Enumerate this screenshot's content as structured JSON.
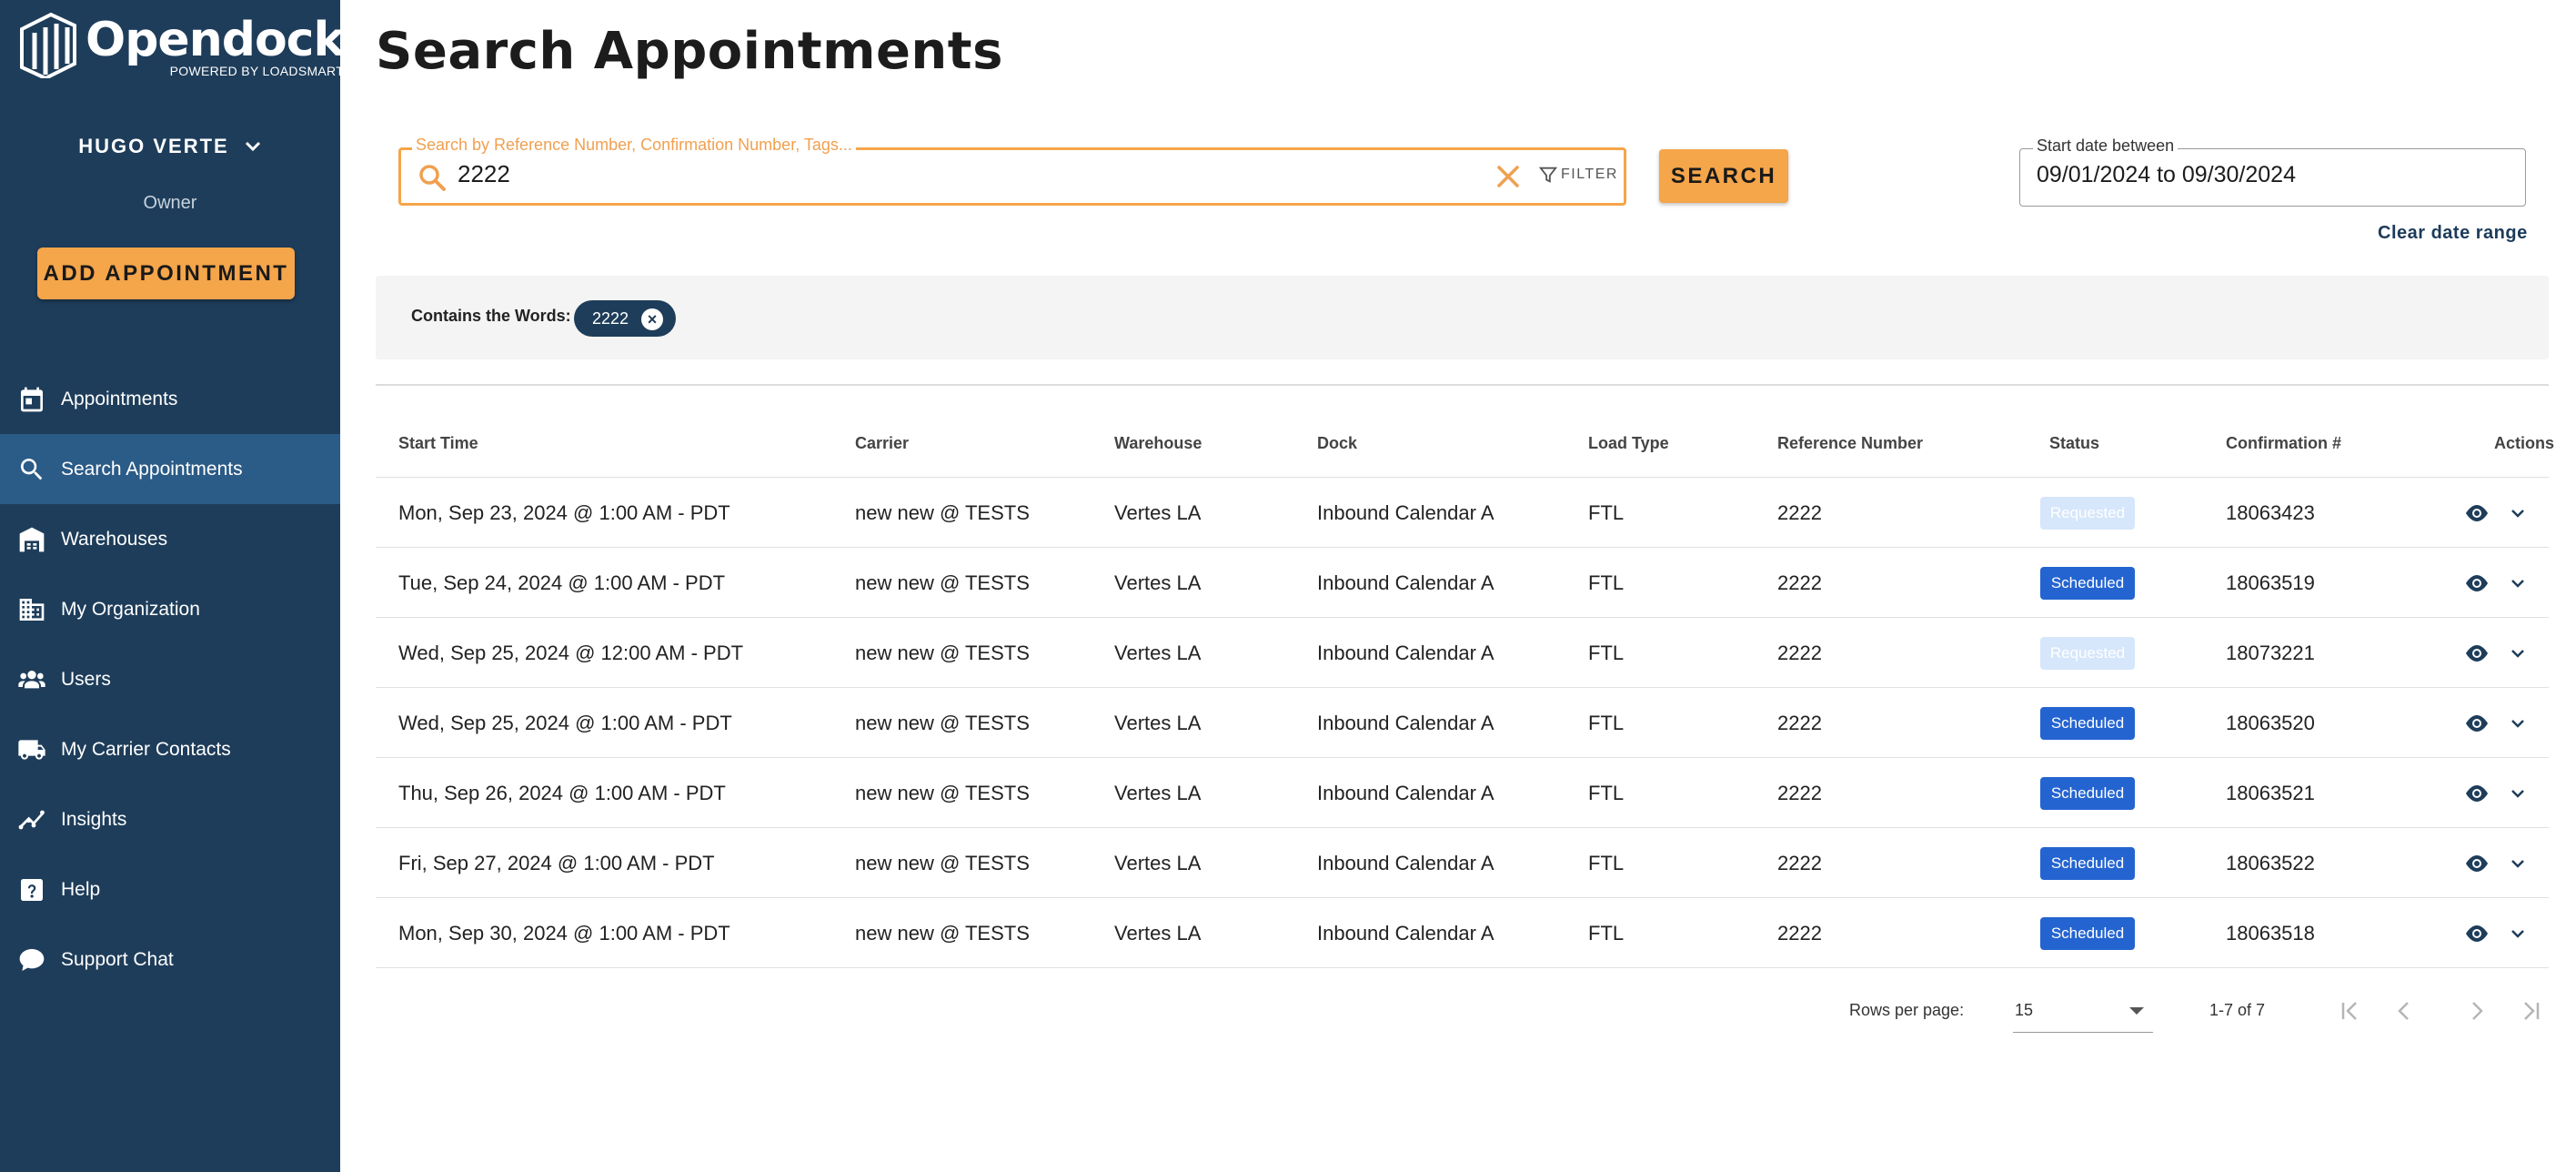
{
  "sidebar": {
    "brand": "Opendock",
    "brand_sub": "POWERED BY LOADSMART",
    "user_name": "HUGO VERTE",
    "user_role": "Owner",
    "add_button": "ADD APPOINTMENT",
    "items": [
      {
        "label": "Appointments",
        "icon": "calendar-icon"
      },
      {
        "label": "Search Appointments",
        "icon": "search-icon"
      },
      {
        "label": "Warehouses",
        "icon": "warehouse-icon"
      },
      {
        "label": "My Organization",
        "icon": "building-icon"
      },
      {
        "label": "Users",
        "icon": "users-icon"
      },
      {
        "label": "My Carrier Contacts",
        "icon": "truck-icon"
      },
      {
        "label": "Insights",
        "icon": "chart-line-icon"
      },
      {
        "label": "Help",
        "icon": "help-icon"
      },
      {
        "label": "Support Chat",
        "icon": "chat-icon"
      }
    ],
    "active_item": "Search Appointments"
  },
  "page": {
    "title": "Search Appointments"
  },
  "search": {
    "label": "Search by Reference Number, Confirmation Number, Tags...",
    "value": "2222",
    "filter_label": "FILTER",
    "button": "SEARCH"
  },
  "date_range": {
    "label": "Start date between",
    "value": "09/01/2024 to 09/30/2024",
    "clear": "Clear date range"
  },
  "filters": {
    "label": "Contains the Words:",
    "chip": "2222"
  },
  "table": {
    "columns": [
      "Start Time",
      "Carrier",
      "Warehouse",
      "Dock",
      "Load Type",
      "Reference Number",
      "Status",
      "Confirmation #",
      "Actions"
    ],
    "rows": [
      {
        "start": "Mon, Sep 23, 2024 @ 1:00 AM - PDT",
        "carrier": "new new @ TESTS",
        "warehouse": "Vertes LA",
        "dock": "Inbound Calendar A",
        "load": "FTL",
        "ref": "2222",
        "status": "Requested",
        "conf": "18063423"
      },
      {
        "start": "Tue, Sep 24, 2024 @ 1:00 AM - PDT",
        "carrier": "new new @ TESTS",
        "warehouse": "Vertes LA",
        "dock": "Inbound Calendar A",
        "load": "FTL",
        "ref": "2222",
        "status": "Scheduled",
        "conf": "18063519"
      },
      {
        "start": "Wed, Sep 25, 2024 @ 12:00 AM - PDT",
        "carrier": "new new @ TESTS",
        "warehouse": "Vertes LA",
        "dock": "Inbound Calendar A",
        "load": "FTL",
        "ref": "2222",
        "status": "Requested",
        "conf": "18073221"
      },
      {
        "start": "Wed, Sep 25, 2024 @ 1:00 AM - PDT",
        "carrier": "new new @ TESTS",
        "warehouse": "Vertes LA",
        "dock": "Inbound Calendar A",
        "load": "FTL",
        "ref": "2222",
        "status": "Scheduled",
        "conf": "18063520"
      },
      {
        "start": "Thu, Sep 26, 2024 @ 1:00 AM - PDT",
        "carrier": "new new @ TESTS",
        "warehouse": "Vertes LA",
        "dock": "Inbound Calendar A",
        "load": "FTL",
        "ref": "2222",
        "status": "Scheduled",
        "conf": "18063521"
      },
      {
        "start": "Fri, Sep 27, 2024 @ 1:00 AM - PDT",
        "carrier": "new new @ TESTS",
        "warehouse": "Vertes LA",
        "dock": "Inbound Calendar A",
        "load": "FTL",
        "ref": "2222",
        "status": "Scheduled",
        "conf": "18063522"
      },
      {
        "start": "Mon, Sep 30, 2024 @ 1:00 AM - PDT",
        "carrier": "new new @ TESTS",
        "warehouse": "Vertes LA",
        "dock": "Inbound Calendar A",
        "load": "FTL",
        "ref": "2222",
        "status": "Scheduled",
        "conf": "18063518"
      }
    ]
  },
  "pagination": {
    "rows_per_page_label": "Rows per page:",
    "rows_per_page": "15",
    "info": "1-7 of 7"
  },
  "colors": {
    "sidebar_bg": "#1e3d5a",
    "active_item_bg": "#2b5b87",
    "accent": "#f5a54a",
    "scheduled": "#2464d1",
    "requested": "#d6e6fb"
  }
}
